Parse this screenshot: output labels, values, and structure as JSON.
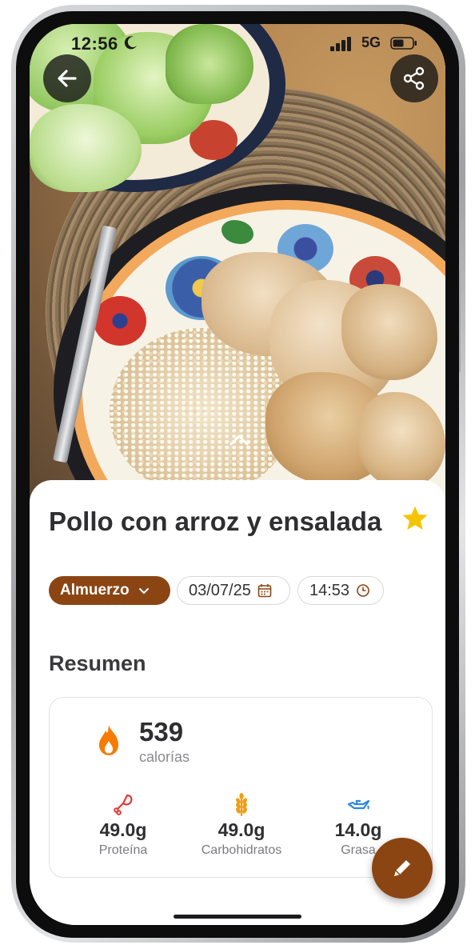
{
  "status_bar": {
    "time": "12:56",
    "network": "5G"
  },
  "meal": {
    "title": "Pollo con arroz y ensalada",
    "type": "Almuerzo",
    "date": "03/07/25",
    "time": "14:53",
    "favorite": true
  },
  "summary": {
    "heading": "Resumen",
    "calories": {
      "value": "539",
      "label": "calorías"
    },
    "macros": [
      {
        "value": "49.0g",
        "label": "Proteína",
        "icon": "drumstick-icon",
        "color": "#e53935"
      },
      {
        "value": "49.0g",
        "label": "Carbohidratos",
        "icon": "wheat-icon",
        "color": "#f39c12"
      },
      {
        "value": "14.0g",
        "label": "Grasa",
        "icon": "oil-icon",
        "color": "#2e86de"
      }
    ]
  },
  "colors": {
    "accent": "#8b4513",
    "star": "#f5c400",
    "flame": "#f57c00"
  }
}
